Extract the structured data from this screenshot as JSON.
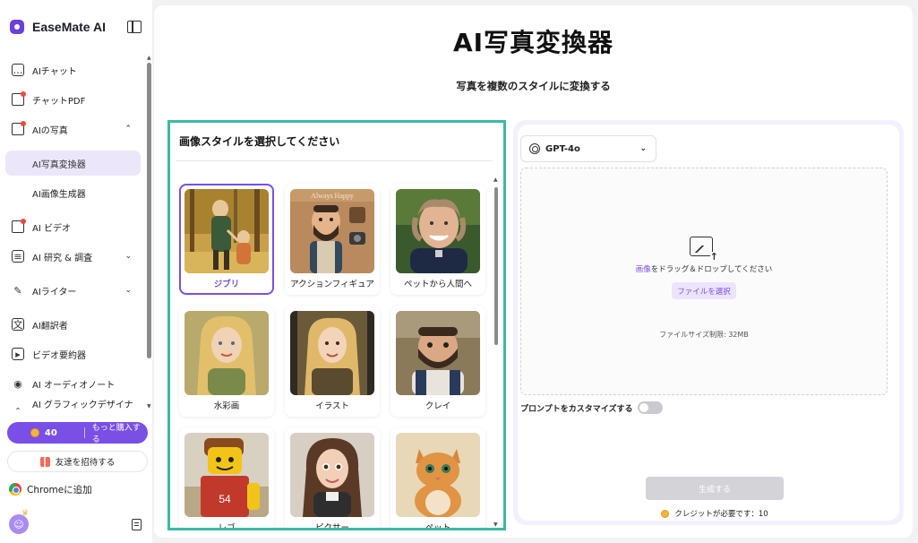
{
  "brand": {
    "name": "EaseMate AI"
  },
  "nav": {
    "items": [
      {
        "label": "AIチャット",
        "icon": "chat-icon"
      },
      {
        "label": "チャットPDF",
        "icon": "pdf-icon"
      },
      {
        "label": "AIの写真",
        "icon": "photo-icon"
      },
      {
        "label": "AI写真変換器",
        "icon": ""
      },
      {
        "label": "AI画像生成器",
        "icon": ""
      },
      {
        "label": "AI ビデオ",
        "icon": "video-icon"
      },
      {
        "label": "AI 研究 & 調査",
        "icon": "research-icon"
      },
      {
        "label": "AIライター",
        "icon": "pen-icon"
      },
      {
        "label": "AI翻訳者",
        "icon": "translate-icon"
      },
      {
        "label": "ビデオ要約器",
        "icon": "play-icon"
      },
      {
        "label": "AI オーディオノート",
        "icon": "audio-icon"
      },
      {
        "label": "AI グラフィックデザイナー",
        "icon": "design-icon"
      }
    ]
  },
  "sidebar_footer": {
    "credits": "40",
    "buy_more": "もっと購入する",
    "invite": "友達を招待する",
    "chrome": "Chromeに追加"
  },
  "page": {
    "title": "AI写真変換器",
    "subtitle": "写真を複数のスタイルに変換する"
  },
  "styles": {
    "header": "画像スタイルを選択してください",
    "cards": [
      {
        "label": "ジブリ",
        "selected": true
      },
      {
        "label": "アクションフィギュア",
        "selected": false
      },
      {
        "label": "ペットから人間へ",
        "selected": false
      },
      {
        "label": "水彩画",
        "selected": false
      },
      {
        "label": "イラスト",
        "selected": false
      },
      {
        "label": "クレイ",
        "selected": false
      },
      {
        "label": "レゴ",
        "selected": false
      },
      {
        "label": "ピクサー",
        "selected": false
      },
      {
        "label": "ペット",
        "selected": false
      }
    ],
    "action_figure_banner": "Always Happy"
  },
  "upload": {
    "model": "GPT-4o",
    "drop_highlight": "画像",
    "drop_text": "をドラッグ＆ドロップしてください",
    "choose_file": "ファイルを選択",
    "size_limit": "ファイルサイズ制限: 32MB",
    "customize_prompt": "プロンプトをカスタマイズする",
    "generate": "生成する",
    "credit_note": "クレジットが必要です：10"
  },
  "colors": {
    "accent": "#7a4fe6",
    "selection_border": "#3db8a5",
    "coin": "#f4b63a"
  }
}
